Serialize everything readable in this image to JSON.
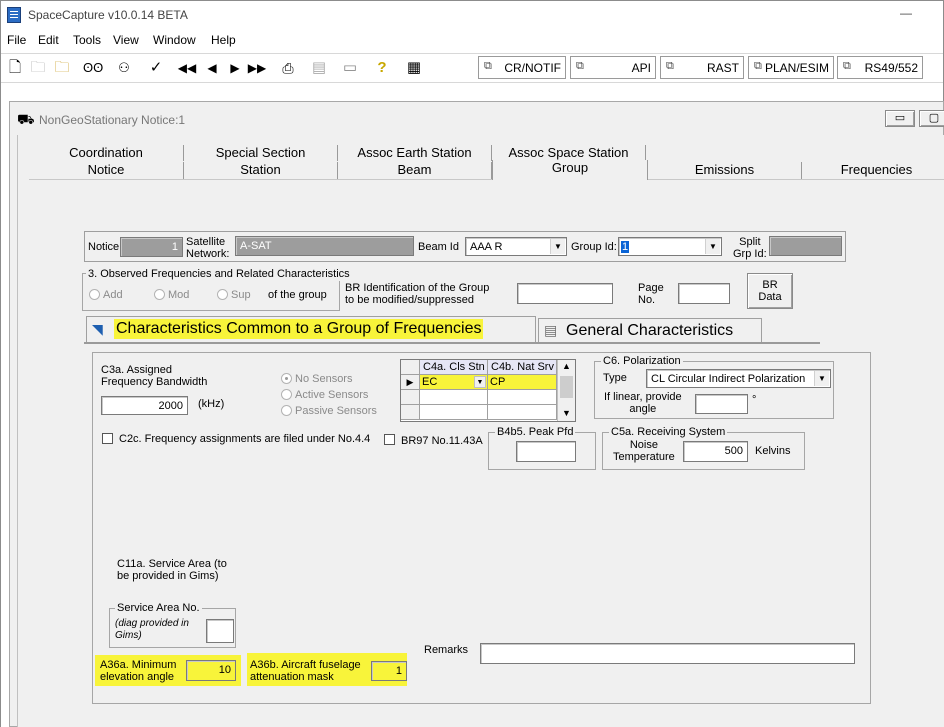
{
  "app": {
    "title": "SpaceCapture v10.0.14 BETA",
    "minimize_glyph": "—"
  },
  "menu": [
    "File",
    "Edit",
    "Tools",
    "View",
    "Window",
    "Help"
  ],
  "toolbar": {
    "window_tabs": [
      "CR/NOTIF",
      "API",
      "RAST",
      "PLAN/ESIM",
      "RS49/552"
    ]
  },
  "child_window": {
    "title": "NonGeoStationary Notice:1"
  },
  "tabs": {
    "row1": [
      "Coordination",
      "Special Section",
      "Assoc Earth Station",
      "Assoc Space Station"
    ],
    "row2": [
      "Notice",
      "Station",
      "Beam",
      "Group",
      "Emissions",
      "Frequencies"
    ],
    "active": "Group"
  },
  "header": {
    "notice_label": "Notice",
    "notice_value": "1",
    "satellite_label": "Satellite\nNetwork:",
    "satellite_value": "A-SAT",
    "beam_label": "Beam Id",
    "beam_value": "AAA R",
    "group_label": "Group Id:",
    "group_value": "1",
    "split_label": "Split\nGrp Id:",
    "split_value": ""
  },
  "observed": {
    "title": "3. Observed Frequencies and Related Characteristics",
    "options": [
      "Add",
      "Mod",
      "Sup"
    ],
    "of_group": "of the group",
    "br_ident_label": "BR Identification of the Group\nto be modified/suppressed",
    "br_ident_value": "",
    "page_label": "Page\nNo.",
    "page_value": "",
    "br_data_button": "BR\nData"
  },
  "subtabs": {
    "characteristics": "Characteristics Common to a Group of Frequencies",
    "general": "General Characteristics"
  },
  "form": {
    "c3a_label": "C3a. Assigned\nFrequency Bandwidth",
    "c3a_value": "2000",
    "c3a_unit": "(kHz)",
    "sensors": [
      "No Sensors",
      "Active Sensors",
      "Passive Sensors"
    ],
    "grid_headers": [
      "C4a. Cls Stn",
      "C4b. Nat Srv"
    ],
    "grid_rows": [
      [
        "EC",
        "CP"
      ],
      [
        "",
        ""
      ],
      [
        "",
        ""
      ]
    ],
    "c6_title": "C6. Polarization",
    "c6_type_label": "Type",
    "c6_type_value": "CL  Circular Indirect Polarization",
    "c6_linear_label": "If linear, provide\nangle",
    "c6_linear_value": "",
    "c6_degree": "°",
    "c2c_label": "C2c. Frequency assignments are filed under No.4.4",
    "br97_label": "BR97 No.11.43A",
    "b4b5_title": "B4b5. Peak Pfd",
    "b4b5_value": "",
    "c5a_title": "C5a.  Receiving System",
    "c5a_noise_label": "Noise\nTemperature",
    "c5a_value": "500",
    "c5a_unit": "Kelvins",
    "c11a_label": "C11a. Service Area (to\nbe provided in Gims)",
    "service_area_title": "Service Area No.",
    "service_area_note": "(diag provided in\nGims)",
    "service_area_value": "",
    "a36a_label": "A36a. Minimum\nelevation angle",
    "a36a_value": "10",
    "a36b_label": "A36b. Aircraft fuselage\nattenuation mask",
    "a36b_value": "1",
    "remarks_label": "Remarks",
    "remarks_value": ""
  },
  "colors": {
    "highlight": "#f8f43a",
    "panel": "#f0f0f0",
    "disabled_field": "#9d9d9d"
  }
}
